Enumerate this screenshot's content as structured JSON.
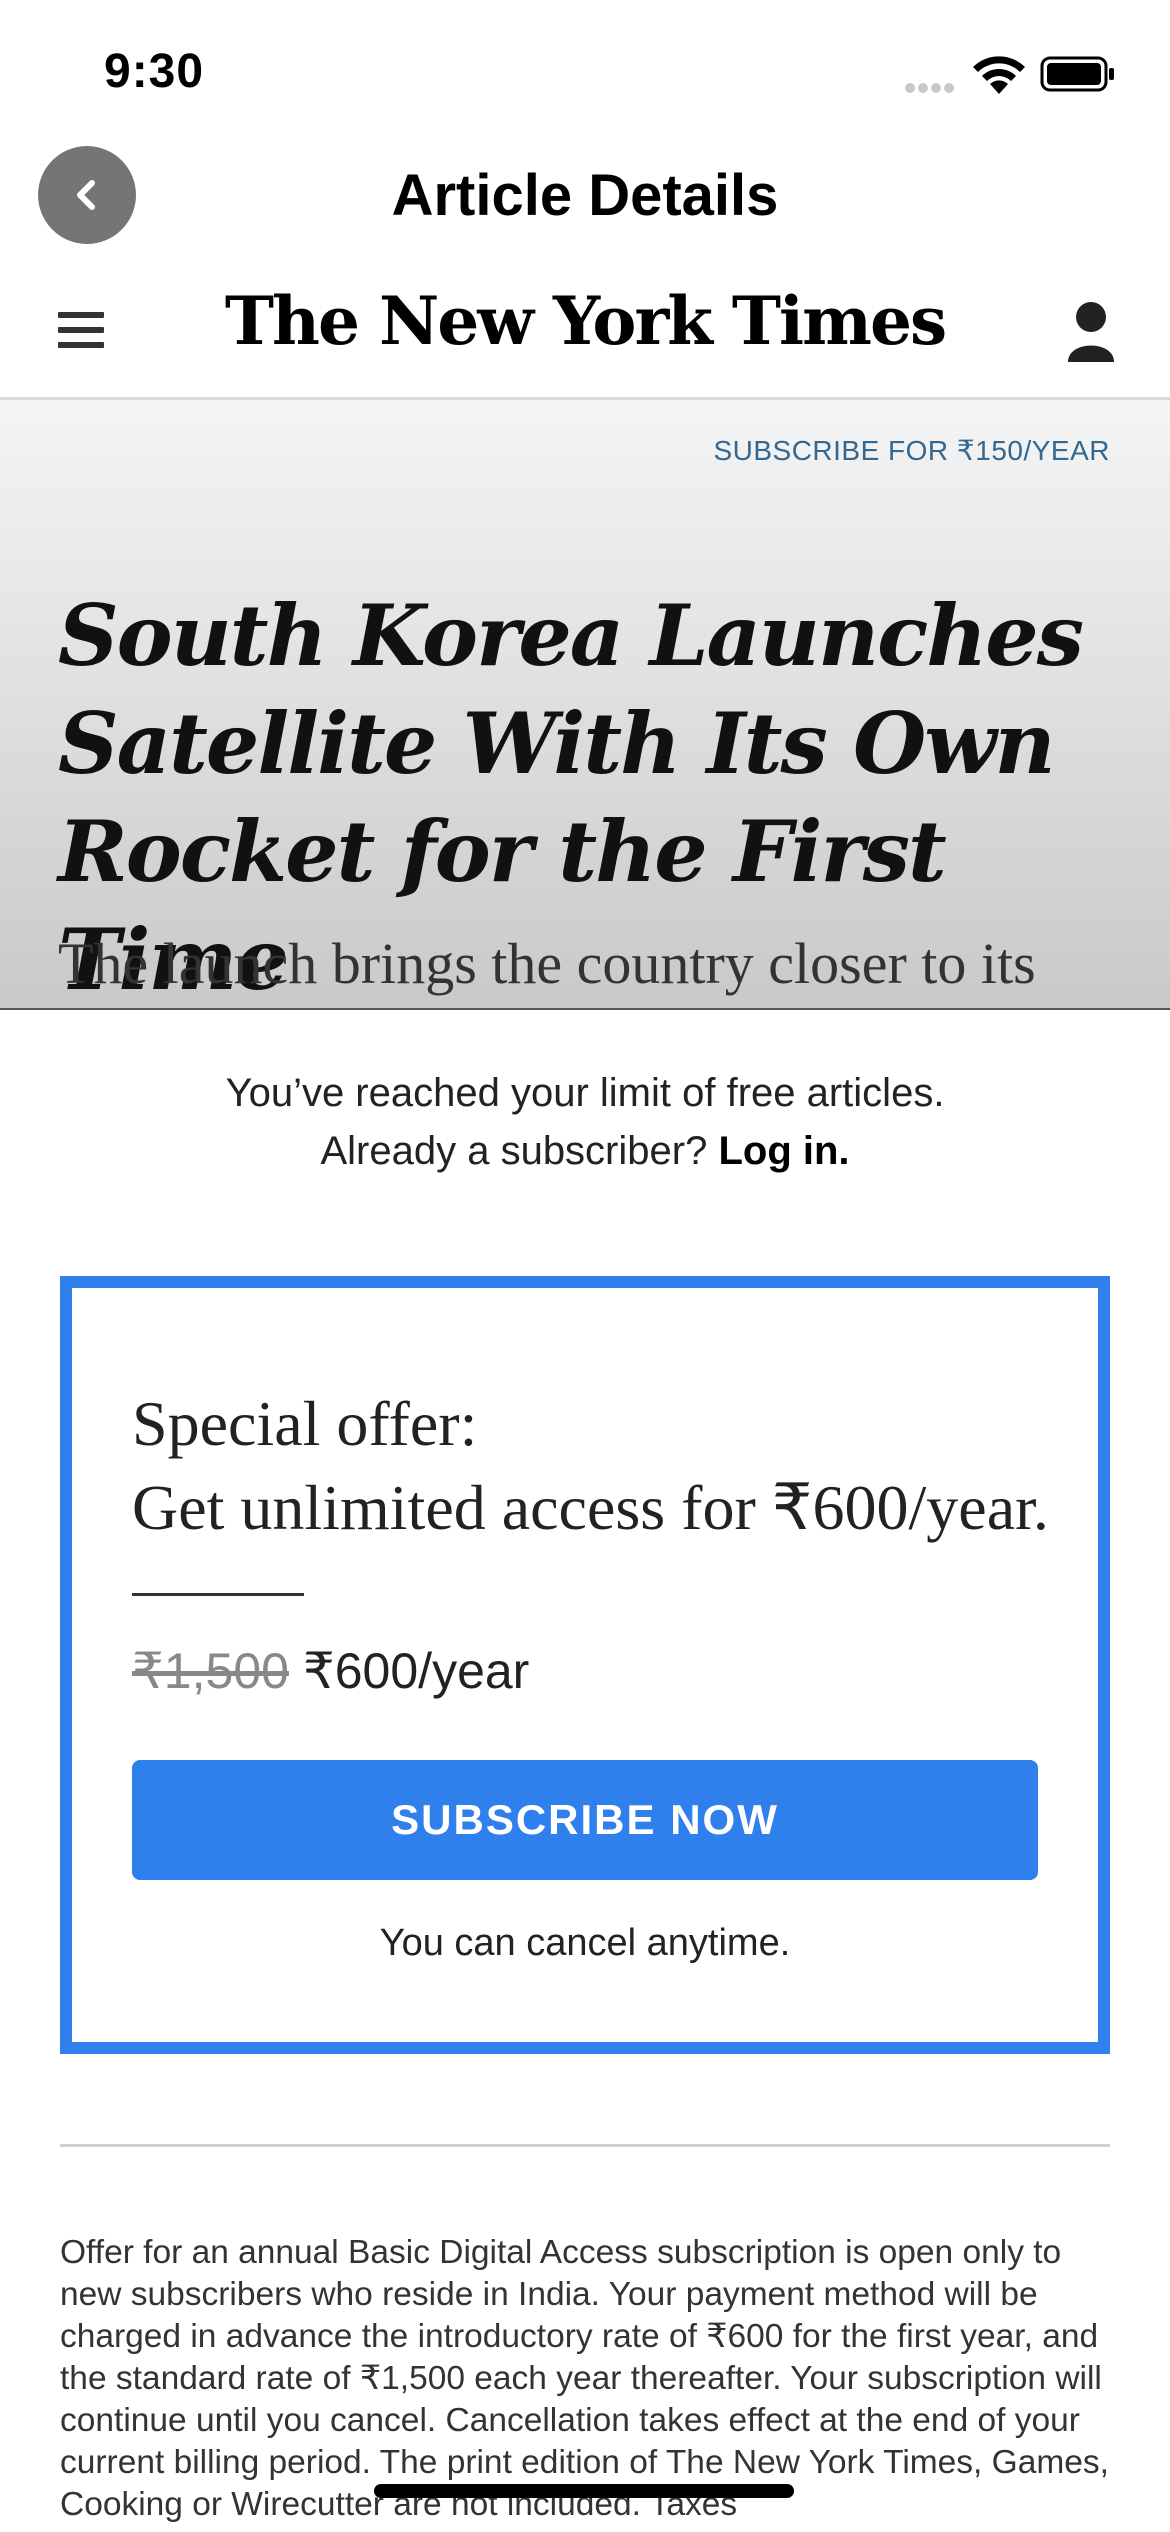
{
  "status_bar": {
    "time": "9:30"
  },
  "nav": {
    "title": "Article Details",
    "back_icon": "chevron-left-icon"
  },
  "nyt_header": {
    "masthead": "The New York Times",
    "menu_icon": "hamburger-menu-icon",
    "account_icon": "person-icon"
  },
  "hero": {
    "subscribe_link": "SUBSCRIBE FOR ₹150/YEAR",
    "headline": "South Korea Launches Satellite With Its Own Rocket for the First Time",
    "summary": "The launch brings the country closer to its"
  },
  "paywall": {
    "limit_message": "You’ve reached your limit of free articles.",
    "subscriber_prompt": "Already a subscriber?",
    "login_label": "Log in."
  },
  "offer": {
    "title_line1": "Special offer:",
    "title_line2": "Get unlimited access for ₹600/year.",
    "old_price": "₹1,500",
    "new_price": "₹600/year",
    "button_label": "SUBSCRIBE NOW",
    "cancel_note": "You can cancel anytime."
  },
  "fine_print": "Offer for an annual Basic Digital Access subscription is open only to new subscribers who reside in India. Your payment method will be charged in advance the introductory rate of ₹600 for the first year, and the standard rate of ₹1,500 each year thereafter. Your subscription will continue until you cancel. Cancellation takes effect at the end of your current billing period. The print edition of The New York Times, Games, Cooking or Wirecutter are not included. Taxes",
  "colors": {
    "accent": "#2f80ed",
    "link_blue": "#326891",
    "back_button": "#757575"
  }
}
